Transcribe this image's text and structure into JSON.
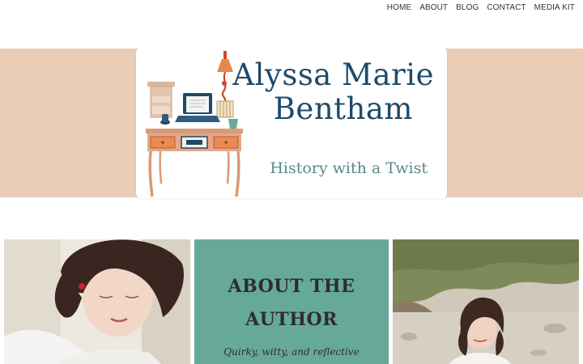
{
  "nav": {
    "items": [
      {
        "label": "HOME"
      },
      {
        "label": "ABOUT"
      },
      {
        "label": "BLOG"
      },
      {
        "label": "CONTACT"
      },
      {
        "label": "MEDIA KIT"
      }
    ]
  },
  "header": {
    "title_line_1": "Alyssa Marie",
    "title_line_2": "Bentham",
    "tagline": "History with a Twist",
    "logo_icon": "writing-desk-illustration",
    "colors": {
      "band": "#ebcdb6",
      "title": "#1e4a6a",
      "tagline": "#5a8a88"
    }
  },
  "about_card": {
    "title": "ABOUT THE AUTHOR",
    "text": "Quirky, witty, and reflective",
    "color": "#67a999"
  }
}
